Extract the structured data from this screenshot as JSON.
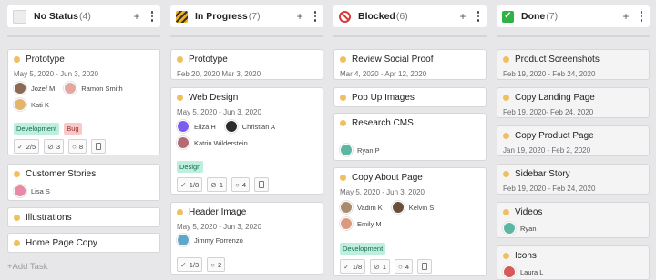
{
  "columns": {
    "no_status": {
      "icon": "empty-status-icon",
      "title": "No Status",
      "count": "(4)"
    },
    "in_progress": {
      "icon": "construction-icon",
      "title": "In Progress",
      "count": "(7)"
    },
    "blocked": {
      "icon": "prohibited-icon",
      "title": "Blocked",
      "count": "(6)"
    },
    "done": {
      "icon": "check-mark-icon",
      "title": "Done",
      "count": "(7)"
    }
  },
  "header_actions": {
    "add": "+",
    "more": "more-vertical-icon"
  },
  "cards": {
    "ns_prototype": {
      "title": "Prototype",
      "date": "May 5, 2020 - Jun 3, 2020",
      "people": [
        "Jozef M",
        "Ramon Smith",
        "Kati K"
      ],
      "tags": [
        "Development",
        "Bug"
      ],
      "metrics": {
        "checks": "2/5",
        "attachments": "3",
        "comments": "8"
      }
    },
    "ns_customer_stories": {
      "title": "Customer Stories",
      "people": [
        "Lisa S"
      ]
    },
    "ns_illustrations": {
      "title": "Illustrations"
    },
    "ns_home_page_copy": {
      "title": "Home Page Copy"
    },
    "ip_prototype": {
      "title": "Prototype",
      "date": "Feb 20, 2020 Mar 3, 2020"
    },
    "ip_web_design": {
      "title": "Web Design",
      "date": "May 5, 2020 - Jun 3, 2020",
      "people": [
        "Eliza H",
        "Christian A",
        "Katrin Wilderstein"
      ],
      "tags": [
        "Design"
      ],
      "metrics": {
        "checks": "1/8",
        "attachments": "1",
        "comments": "4"
      }
    },
    "ip_header_image": {
      "title": "Header Image",
      "date": "May 5, 2020 - Jun 3, 2020",
      "people": [
        "Jimmy Forrenzo"
      ],
      "metrics": {
        "checks": "1/3",
        "comments": "2"
      }
    },
    "bl_review_social_proof": {
      "title": "Review Social Proof",
      "date": "Mar 4, 2020 - Apr 12, 2020"
    },
    "bl_pop_up_images": {
      "title": "Pop Up Images"
    },
    "bl_research_cms": {
      "title": "Research CMS",
      "people": [
        "Ryan P"
      ]
    },
    "bl_copy_about_page": {
      "title": "Copy About Page",
      "date": "May 5, 2020 - Jun 3, 2020",
      "people": [
        "Vadim K",
        "Kelvin S",
        "Emily M"
      ],
      "tags": [
        "Development"
      ],
      "metrics": {
        "checks": "1/8",
        "attachments": "1",
        "comments": "4"
      }
    },
    "dn_product_screenshots": {
      "title": "Product Screenshots",
      "date": "Feb 19, 2020 - Feb 24, 2020"
    },
    "dn_copy_landing_page": {
      "title": "Copy Landing Page",
      "date": "Feb 19, 2020- Feb 24, 2020"
    },
    "dn_copy_product_page": {
      "title": "Copy Product Page",
      "date": "Jan 19, 2020 - Feb 2, 2020"
    },
    "dn_sidebar_story": {
      "title": "Sidebar Story",
      "date": "Feb 19, 2020 - Feb 24, 2020"
    },
    "dn_videos": {
      "title": "Videos",
      "people": [
        "Ryan"
      ]
    },
    "dn_icons": {
      "title": "Icons",
      "people": [
        "Laura L"
      ]
    }
  },
  "add_task": "+Add Task",
  "colors": {
    "background": "#e7e7e9",
    "card": "#ffffff",
    "priority_dot": "#f0c060",
    "tag_development": "#bdeede",
    "tag_bug": "#f9c9c9",
    "done_status": "#2fb344",
    "blocked_status": "#d63b3b",
    "in_progress_status": "#f2b01e"
  }
}
